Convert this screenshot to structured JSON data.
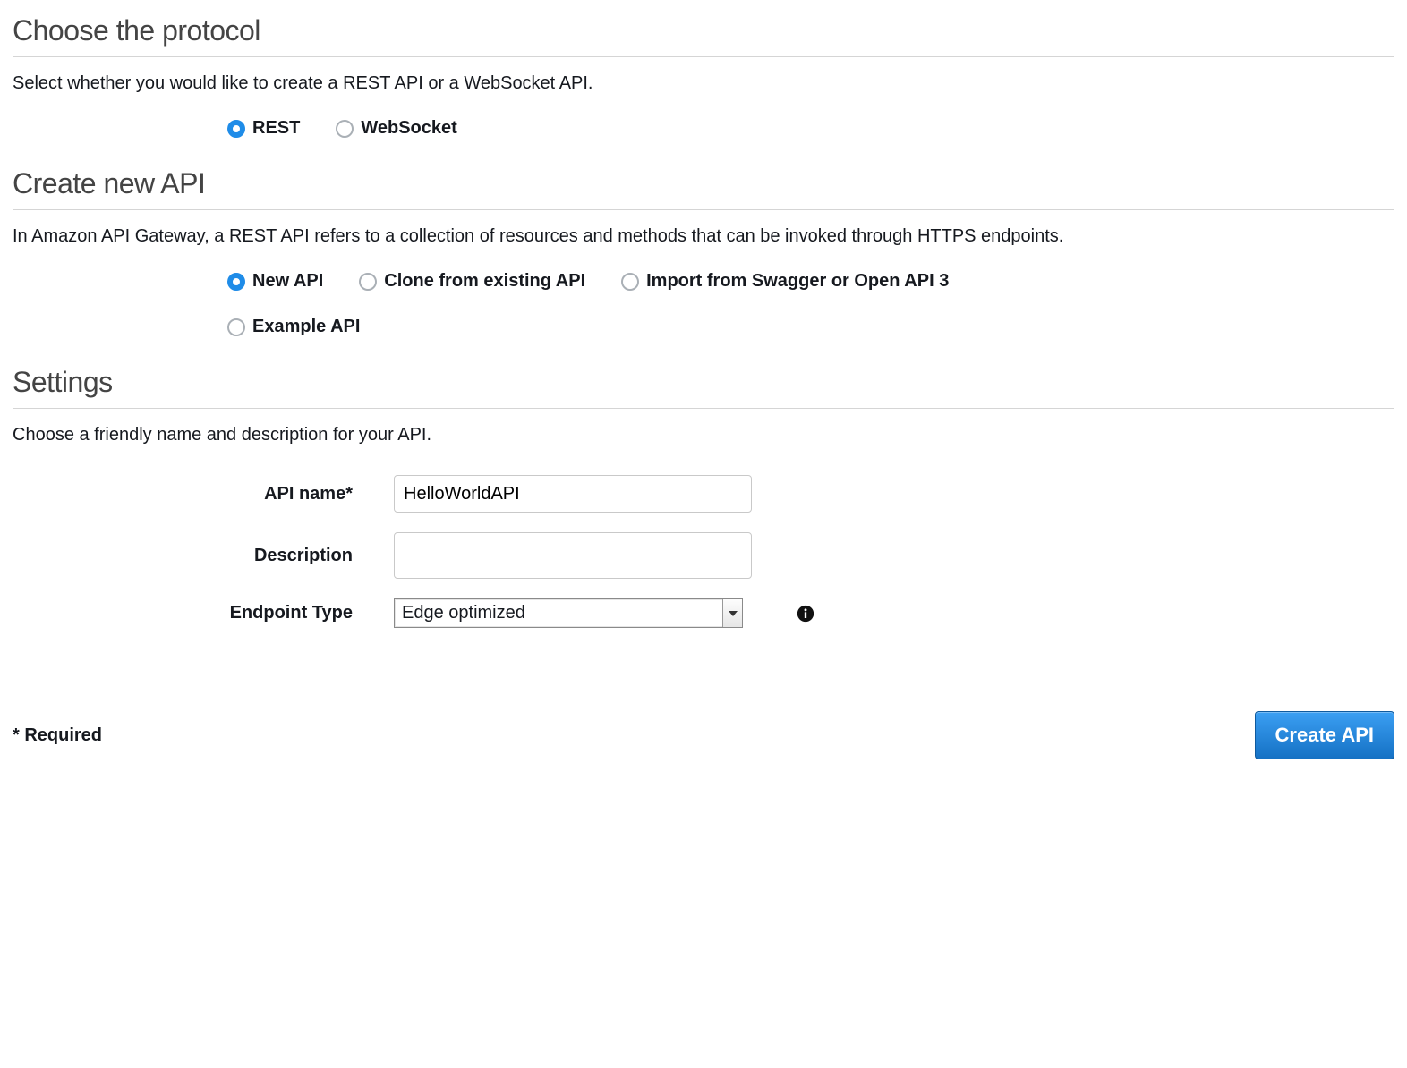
{
  "sections": {
    "protocol": {
      "title": "Choose the protocol",
      "desc": "Select whether you would like to create a REST API or a WebSocket API.",
      "options": {
        "rest": "REST",
        "websocket": "WebSocket"
      },
      "selected": "rest"
    },
    "create": {
      "title": "Create new API",
      "desc": "In Amazon API Gateway, a REST API refers to a collection of resources and methods that can be invoked through HTTPS endpoints.",
      "options": {
        "new": "New API",
        "clone": "Clone from existing API",
        "import": "Import from Swagger or Open API 3",
        "example": "Example API"
      },
      "selected": "new"
    },
    "settings": {
      "title": "Settings",
      "desc": "Choose a friendly name and description for your API.",
      "fields": {
        "api_name": {
          "label": "API name*",
          "value": "HelloWorldAPI"
        },
        "description": {
          "label": "Description",
          "value": ""
        },
        "endpoint_type": {
          "label": "Endpoint Type",
          "value": "Edge optimized"
        }
      }
    }
  },
  "footer": {
    "required_note": "* Required",
    "create_button": "Create API"
  }
}
